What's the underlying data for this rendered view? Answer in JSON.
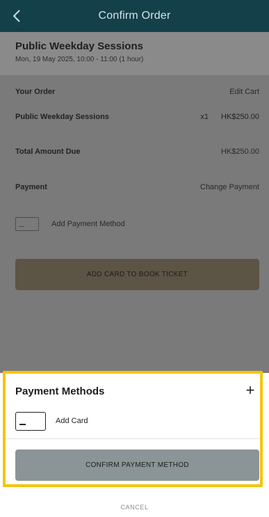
{
  "header": {
    "title": "Confirm Order",
    "back_icon": "chevron-left-icon"
  },
  "session": {
    "title": "Public Weekday Sessions",
    "datetime": "Mon, 19 May 2025, 10:00 - 11:00 (1 hour)"
  },
  "order": {
    "label": "Your Order",
    "edit_label": "Edit Cart",
    "item_name": "Public Weekday Sessions",
    "item_qty": "x1",
    "item_price": "HK$250.00",
    "total_label": "Total Amount Due",
    "total_value": "HK$250.00"
  },
  "payment": {
    "label": "Payment",
    "change_label": "Change Payment",
    "add_method_label": "Add Payment Method",
    "book_button_label": "ADD CARD TO BOOK TICKET"
  },
  "sheet": {
    "title": "Payment Methods",
    "plus_label": "+",
    "add_card_label": "Add Card",
    "confirm_button_label": "CONFIRM PAYMENT METHOD",
    "cancel_label": "CANCEL",
    "highlight_color": "#f6c409"
  }
}
